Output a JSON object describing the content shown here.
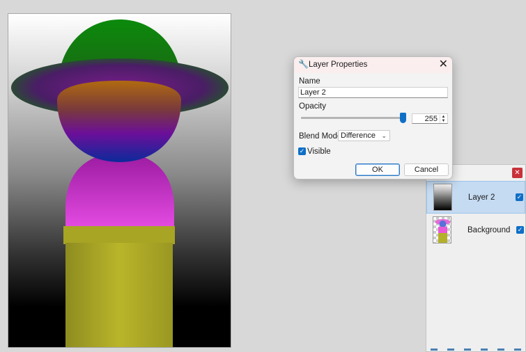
{
  "dialog": {
    "title": "Layer Properties",
    "icon": "wrench-icon",
    "close_glyph": "✕",
    "name_label": "Name",
    "name_value": "Layer 2",
    "opacity_label": "Opacity",
    "opacity_value": "255",
    "opacity_fraction": 1.0,
    "blend_label": "Blend Mode:",
    "blend_value": "Difference",
    "visible_label": "Visible",
    "visible_checked": true,
    "ok_label": "OK",
    "cancel_label": "Cancel"
  },
  "layers": {
    "close_glyph": "✕",
    "items": [
      {
        "name": "Layer 2",
        "selected": true,
        "visible": true,
        "thumb": "gradient"
      },
      {
        "name": "Background",
        "selected": false,
        "visible": true,
        "thumb": "figure"
      }
    ]
  },
  "colors": {
    "accent": "#0f6fc6",
    "selection": "#c5dbf2",
    "close_red": "#c8313a"
  }
}
